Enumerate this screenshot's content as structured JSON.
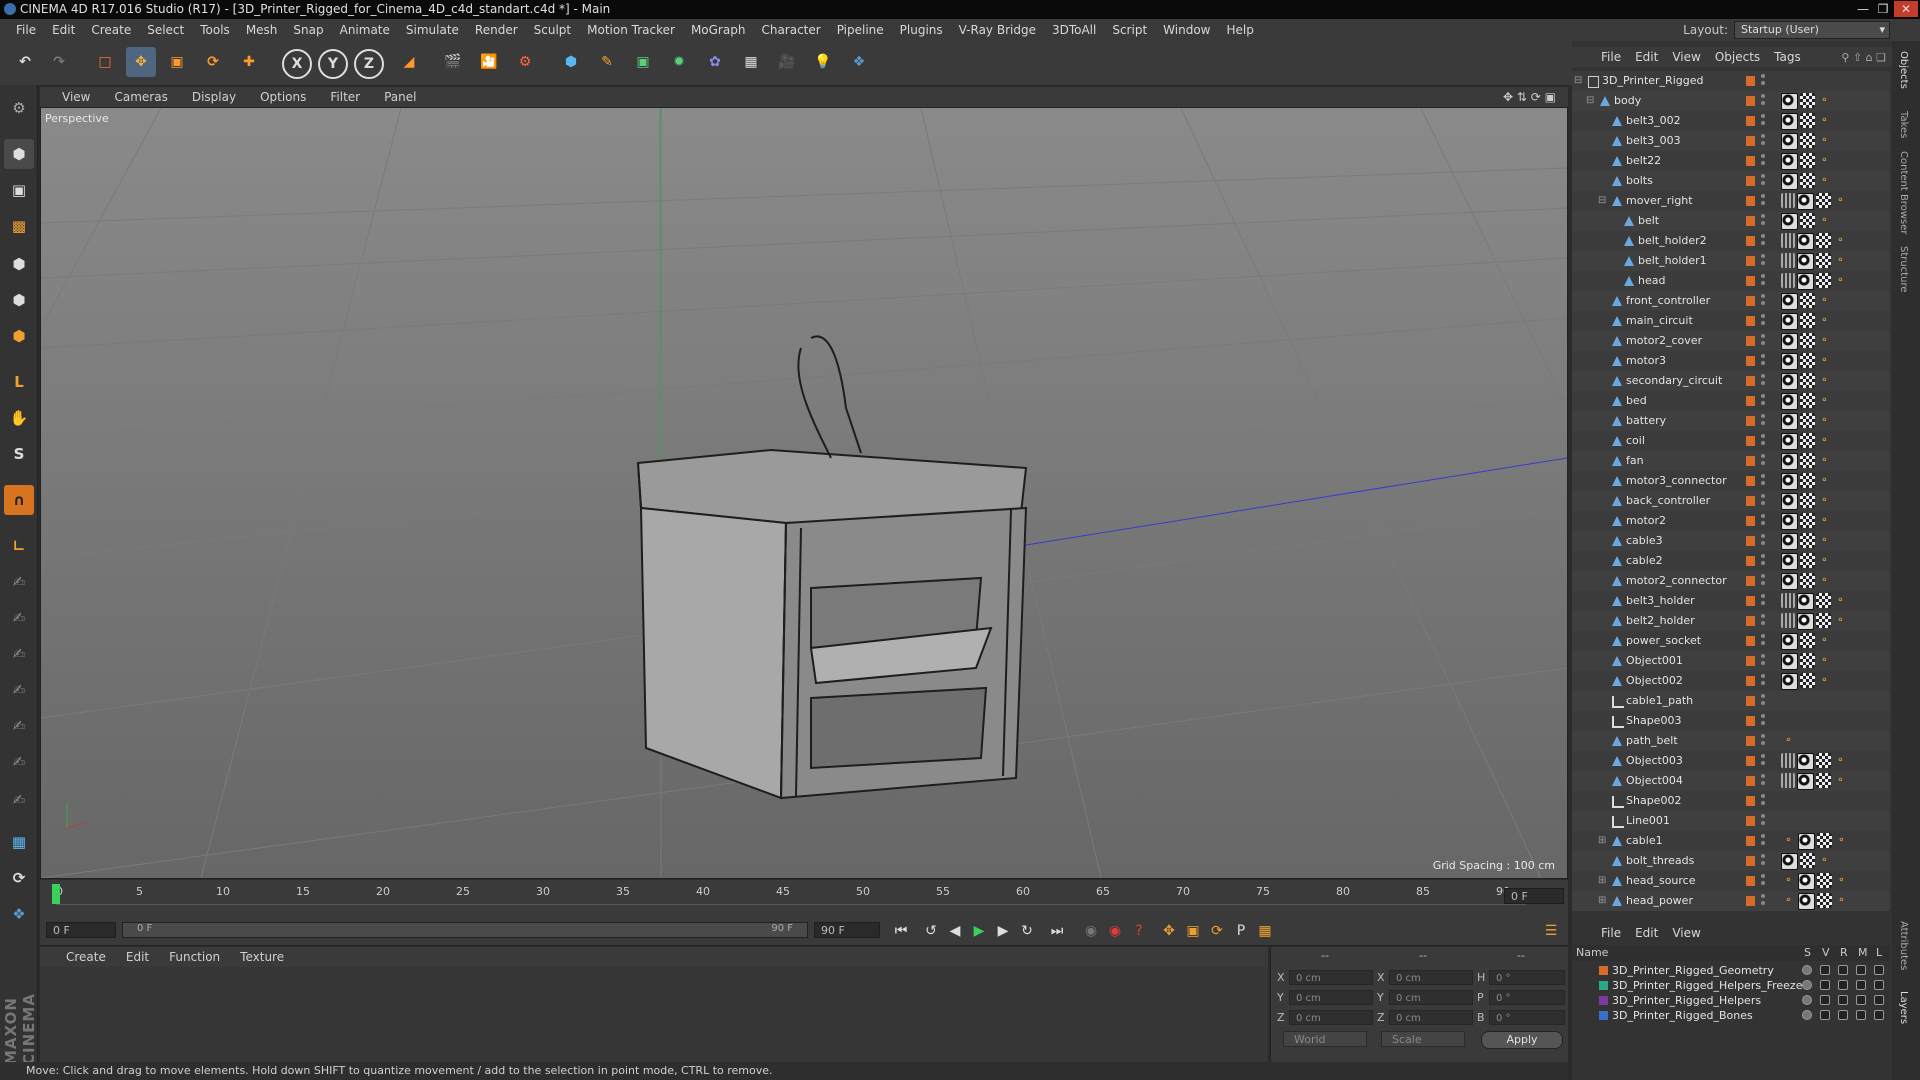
{
  "window": {
    "title": "CINEMA 4D R17.016 Studio (R17) - [3D_Printer_Rigged_for_Cinema_4D_c4d_standart.c4d *] - Main"
  },
  "menu": [
    "File",
    "Edit",
    "Create",
    "Select",
    "Tools",
    "Mesh",
    "Snap",
    "Animate",
    "Simulate",
    "Render",
    "Sculpt",
    "Motion Tracker",
    "MoGraph",
    "Character",
    "Pipeline",
    "Plugins",
    "V-Ray Bridge",
    "3DToAll",
    "Script",
    "Window",
    "Help"
  ],
  "layout": {
    "label": "Layout:",
    "value": "Startup (User)"
  },
  "viewport": {
    "menu": [
      "View",
      "Cameras",
      "Display",
      "Options",
      "Filter",
      "Panel"
    ],
    "label": "Perspective",
    "grid_spacing": "Grid Spacing : 100 cm"
  },
  "timeline": {
    "ticks": [
      "0",
      "5",
      "10",
      "15",
      "20",
      "25",
      "30",
      "35",
      "40",
      "45",
      "50",
      "55",
      "60",
      "65",
      "70",
      "75",
      "80",
      "85",
      "90"
    ],
    "current_frame": "0 F",
    "start_field": "0 F",
    "range_start": "0 F",
    "range_end": "90 F",
    "end_field": "90 F"
  },
  "material": {
    "menu": [
      "Create",
      "Edit",
      "Function",
      "Texture"
    ]
  },
  "coords": {
    "header": [
      "--",
      "--",
      "--"
    ],
    "rows": [
      {
        "a": "X",
        "av": "0 cm",
        "b": "X",
        "bv": "0 cm",
        "c": "H",
        "cv": "0 °"
      },
      {
        "a": "Y",
        "av": "0 cm",
        "b": "Y",
        "bv": "0 cm",
        "c": "P",
        "cv": "0 °"
      },
      {
        "a": "Z",
        "av": "0 cm",
        "b": "Z",
        "bv": "0 cm",
        "c": "B",
        "cv": "0 °"
      }
    ],
    "world": "World",
    "scale": "Scale",
    "apply": "Apply"
  },
  "status": "Move: Click and drag to move elements. Hold down SHIFT to quantize movement / add to the selection in point mode, CTRL to remove.",
  "objects": {
    "menu": [
      "File",
      "Edit",
      "View",
      "Objects",
      "Tags"
    ],
    "items": [
      {
        "name": "3D_Printer_Rigged",
        "depth": 0,
        "icon": "null",
        "exp": "-",
        "tags": []
      },
      {
        "name": "body",
        "depth": 1,
        "icon": "joint",
        "exp": "-",
        "tags": [
          "phong",
          "check",
          "ik"
        ]
      },
      {
        "name": "belt3_002",
        "depth": 2,
        "icon": "joint",
        "exp": "",
        "tags": [
          "phong",
          "check",
          "ik"
        ]
      },
      {
        "name": "belt3_003",
        "depth": 2,
        "icon": "joint",
        "exp": "",
        "tags": [
          "phong",
          "check",
          "ik"
        ]
      },
      {
        "name": "belt22",
        "depth": 2,
        "icon": "joint",
        "exp": "",
        "tags": [
          "phong",
          "check",
          "ik"
        ]
      },
      {
        "name": "bolts",
        "depth": 2,
        "icon": "joint",
        "exp": "",
        "tags": [
          "phong",
          "check",
          "ik"
        ]
      },
      {
        "name": "mover_right",
        "depth": 2,
        "icon": "joint",
        "exp": "-",
        "tags": [
          "sel",
          "phong",
          "check",
          "ik"
        ]
      },
      {
        "name": "belt",
        "depth": 3,
        "icon": "joint",
        "exp": "",
        "tags": [
          "phong",
          "check",
          "ik"
        ]
      },
      {
        "name": "belt_holder2",
        "depth": 3,
        "icon": "joint",
        "exp": "",
        "tags": [
          "sel",
          "phong",
          "check",
          "ik"
        ]
      },
      {
        "name": "belt_holder1",
        "depth": 3,
        "icon": "joint",
        "exp": "",
        "tags": [
          "sel",
          "phong",
          "check",
          "ik"
        ]
      },
      {
        "name": "head",
        "depth": 3,
        "icon": "joint",
        "exp": "",
        "tags": [
          "sel",
          "phong",
          "check",
          "ik"
        ]
      },
      {
        "name": "front_controller",
        "depth": 2,
        "icon": "joint",
        "exp": "",
        "tags": [
          "phong",
          "check",
          "ik"
        ]
      },
      {
        "name": "main_circuit",
        "depth": 2,
        "icon": "joint",
        "exp": "",
        "tags": [
          "phong",
          "check",
          "ik"
        ]
      },
      {
        "name": "motor2_cover",
        "depth": 2,
        "icon": "joint",
        "exp": "",
        "tags": [
          "phong",
          "check",
          "ik"
        ]
      },
      {
        "name": "motor3",
        "depth": 2,
        "icon": "joint",
        "exp": "",
        "tags": [
          "phong",
          "check",
          "ik"
        ]
      },
      {
        "name": "secondary_circuit",
        "depth": 2,
        "icon": "joint",
        "exp": "",
        "tags": [
          "phong",
          "check",
          "ik"
        ]
      },
      {
        "name": "bed",
        "depth": 2,
        "icon": "joint",
        "exp": "",
        "tags": [
          "phong",
          "check",
          "ik"
        ]
      },
      {
        "name": "battery",
        "depth": 2,
        "icon": "joint",
        "exp": "",
        "tags": [
          "phong",
          "check",
          "ik"
        ]
      },
      {
        "name": "coil",
        "depth": 2,
        "icon": "joint",
        "exp": "",
        "tags": [
          "phong",
          "check",
          "ik"
        ]
      },
      {
        "name": "fan",
        "depth": 2,
        "icon": "joint",
        "exp": "",
        "tags": [
          "phong",
          "check",
          "ik"
        ]
      },
      {
        "name": "motor3_connector",
        "depth": 2,
        "icon": "joint",
        "exp": "",
        "tags": [
          "phong",
          "check",
          "ik"
        ]
      },
      {
        "name": "back_controller",
        "depth": 2,
        "icon": "joint",
        "exp": "",
        "tags": [
          "phong",
          "check",
          "ik"
        ]
      },
      {
        "name": "motor2",
        "depth": 2,
        "icon": "joint",
        "exp": "",
        "tags": [
          "phong",
          "check",
          "ik"
        ]
      },
      {
        "name": "cable3",
        "depth": 2,
        "icon": "joint",
        "exp": "",
        "tags": [
          "phong",
          "check",
          "ik"
        ]
      },
      {
        "name": "cable2",
        "depth": 2,
        "icon": "joint",
        "exp": "",
        "tags": [
          "phong",
          "check",
          "ik"
        ]
      },
      {
        "name": "motor2_connector",
        "depth": 2,
        "icon": "joint",
        "exp": "",
        "tags": [
          "phong",
          "check",
          "ik"
        ]
      },
      {
        "name": "belt3_holder",
        "depth": 2,
        "icon": "joint",
        "exp": "",
        "tags": [
          "sel",
          "phong",
          "check",
          "ik"
        ]
      },
      {
        "name": "belt2_holder",
        "depth": 2,
        "icon": "joint",
        "exp": "",
        "tags": [
          "sel",
          "phong",
          "check",
          "ik"
        ]
      },
      {
        "name": "power_socket",
        "depth": 2,
        "icon": "joint",
        "exp": "",
        "tags": [
          "phong",
          "check",
          "ik"
        ]
      },
      {
        "name": "Object001",
        "depth": 2,
        "icon": "joint",
        "exp": "",
        "tags": [
          "phong",
          "check",
          "ik"
        ]
      },
      {
        "name": "Object002",
        "depth": 2,
        "icon": "joint",
        "exp": "",
        "tags": [
          "phong",
          "check",
          "ik"
        ]
      },
      {
        "name": "cable1_path",
        "depth": 2,
        "icon": "spline",
        "exp": "",
        "tags": []
      },
      {
        "name": "Shape003",
        "depth": 2,
        "icon": "spline",
        "exp": "",
        "tags": []
      },
      {
        "name": "path_belt",
        "depth": 2,
        "icon": "joint",
        "exp": "",
        "tags": [
          "ik"
        ]
      },
      {
        "name": "Object003",
        "depth": 2,
        "icon": "joint",
        "exp": "",
        "tags": [
          "sel",
          "phong",
          "check",
          "ik"
        ]
      },
      {
        "name": "Object004",
        "depth": 2,
        "icon": "joint",
        "exp": "",
        "tags": [
          "sel",
          "phong",
          "check",
          "ik"
        ]
      },
      {
        "name": "Shape002",
        "depth": 2,
        "icon": "spline",
        "exp": "",
        "tags": []
      },
      {
        "name": "Line001",
        "depth": 2,
        "icon": "spline",
        "exp": "",
        "tags": []
      },
      {
        "name": "cable1",
        "depth": 2,
        "icon": "joint",
        "exp": "+",
        "tags": [
          "ik",
          "phong",
          "check",
          "ik"
        ]
      },
      {
        "name": "bolt_threads",
        "depth": 2,
        "icon": "joint",
        "exp": "",
        "tags": [
          "phong",
          "check",
          "ik"
        ]
      },
      {
        "name": "head_source",
        "depth": 2,
        "icon": "joint",
        "exp": "+",
        "tags": [
          "ik",
          "phong",
          "check",
          "ik"
        ]
      },
      {
        "name": "head_power",
        "depth": 2,
        "icon": "joint",
        "exp": "+",
        "tags": [
          "ik",
          "phong",
          "check",
          "ik"
        ]
      }
    ]
  },
  "layers": {
    "menu": [
      "File",
      "Edit",
      "View"
    ],
    "headers": {
      "name": "Name",
      "s": "S",
      "v": "V",
      "r": "R",
      "m": "M",
      "l": "L"
    },
    "items": [
      {
        "name": "3D_Printer_Rigged_Geometry",
        "color": "#d86a2a"
      },
      {
        "name": "3D_Printer_Rigged_Helpers_Freeze",
        "color": "#2aa88a"
      },
      {
        "name": "3D_Printer_Rigged_Helpers",
        "color": "#7a3aa0"
      },
      {
        "name": "3D_Printer_Rigged_Bones",
        "color": "#3a6ec8"
      }
    ]
  },
  "side_tabs": [
    "Objects",
    "Takes",
    "Content Browser",
    "Structure",
    "Attributes",
    "Layers"
  ],
  "brand": "MAXON CINEMA 4D"
}
